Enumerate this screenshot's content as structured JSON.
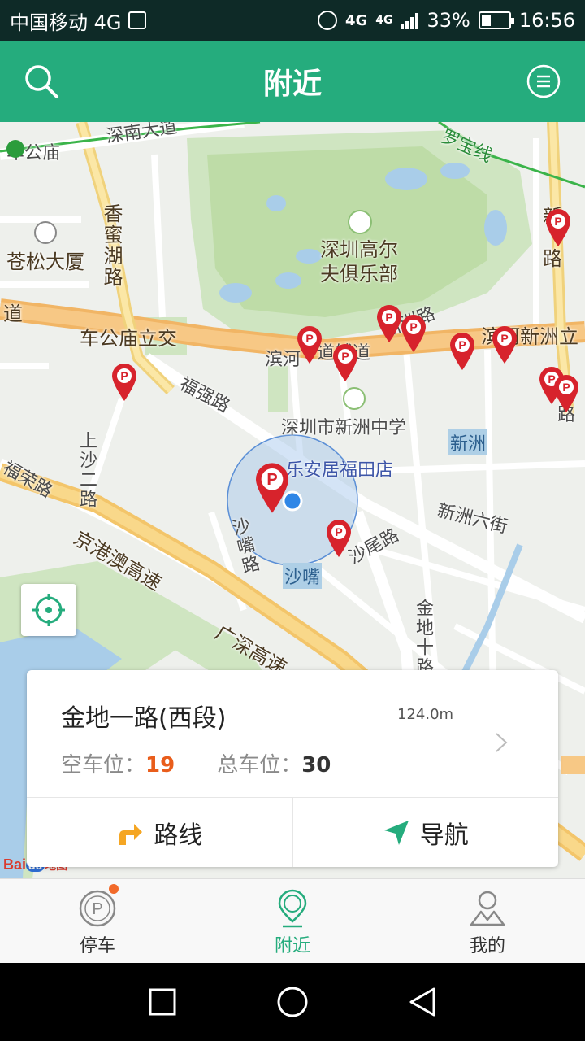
{
  "status_bar": {
    "carrier": "中国移动 4G",
    "network": "4G",
    "network_small": "4G",
    "battery_percent": "33%",
    "battery_level": 0.33,
    "time": "16:56"
  },
  "header": {
    "title": "附近",
    "search_icon": "search-icon",
    "menu_icon": "menu-icon"
  },
  "map": {
    "labels": {
      "chegongmiao": "车公庙",
      "shennan": "深南大道",
      "luobao": "罗宝线",
      "xiangmi": "香蜜湖路",
      "cangsong": "苍松大厦",
      "golf": "深圳高尔夫俱乐部",
      "dao": "道",
      "chegongmiao_interchange": "车公庙立交",
      "binhe_1": "滨河",
      "binhe_2": "道辅道",
      "xinzhou_r": "新洲路",
      "binhe_xinzhou": "滨河新洲立",
      "fuqiang": "福强路",
      "middle_school": "深圳市新洲中学",
      "xinzhou_area": "新洲",
      "shangsha": "上沙二路",
      "furong": "福荣路",
      "store": "乐安居福田店",
      "xinzhou6": "新洲六街",
      "jinggang": "京港澳高速",
      "shazui_rd": "沙嘴路",
      "shawei": "沙尾路",
      "shazui_area": "沙嘴",
      "guangshen": "广深高速",
      "jindi10": "金地十路",
      "lu": "路",
      "xin_top": "新",
      "lu_top": "路"
    },
    "locate_icon": "locate-icon",
    "logo_text": "Bai",
    "logo_badge": "du",
    "logo_map": "地图"
  },
  "card": {
    "title": "金地一路(西段)",
    "distance": "124.0m",
    "empty_label": "空车位：",
    "empty_value": "19",
    "total_label": "总车位：",
    "total_value": "30",
    "route_label": "路线",
    "navigate_label": "导航"
  },
  "tabs": [
    {
      "label": "停车",
      "icon": "parking-icon",
      "badge": true
    },
    {
      "label": "附近",
      "icon": "location-pin-icon",
      "active": true
    },
    {
      "label": "我的",
      "icon": "user-icon"
    }
  ],
  "colors": {
    "brand": "#25ac7d",
    "accent": "#e95d1b",
    "pin": "#d7232c"
  }
}
